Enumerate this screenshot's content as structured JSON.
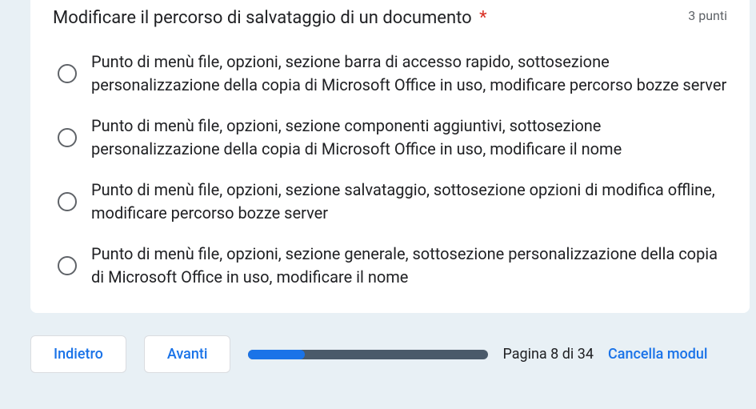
{
  "question": {
    "title": "Modificare il percorso di salvataggio di un documento",
    "required_marker": "*",
    "points_label": "3 punti"
  },
  "options": [
    {
      "text": "Punto di menù file, opzioni, sezione barra di accesso rapido, sottosezione personalizzazione della copia di Microsoft Office in uso, modificare percorso bozze server"
    },
    {
      "text": "Punto di menù file, opzioni, sezione componenti aggiuntivi, sottosezione personalizzazione della copia di Microsoft Office in uso, modificare il nome"
    },
    {
      "text": "Punto di menù file, opzioni, sezione salvataggio, sottosezione opzioni di modifica offline, modificare percorso bozze server"
    },
    {
      "text": "Punto di menù file, opzioni, sezione generale, sottosezione personalizzazione della copia di Microsoft Office in uso, modificare il nome"
    }
  ],
  "footer": {
    "back_label": "Indietro",
    "next_label": "Avanti",
    "page_info": "Pagina 8 di 34",
    "clear_label": "Cancella modul",
    "progress_percent": 23.5
  }
}
